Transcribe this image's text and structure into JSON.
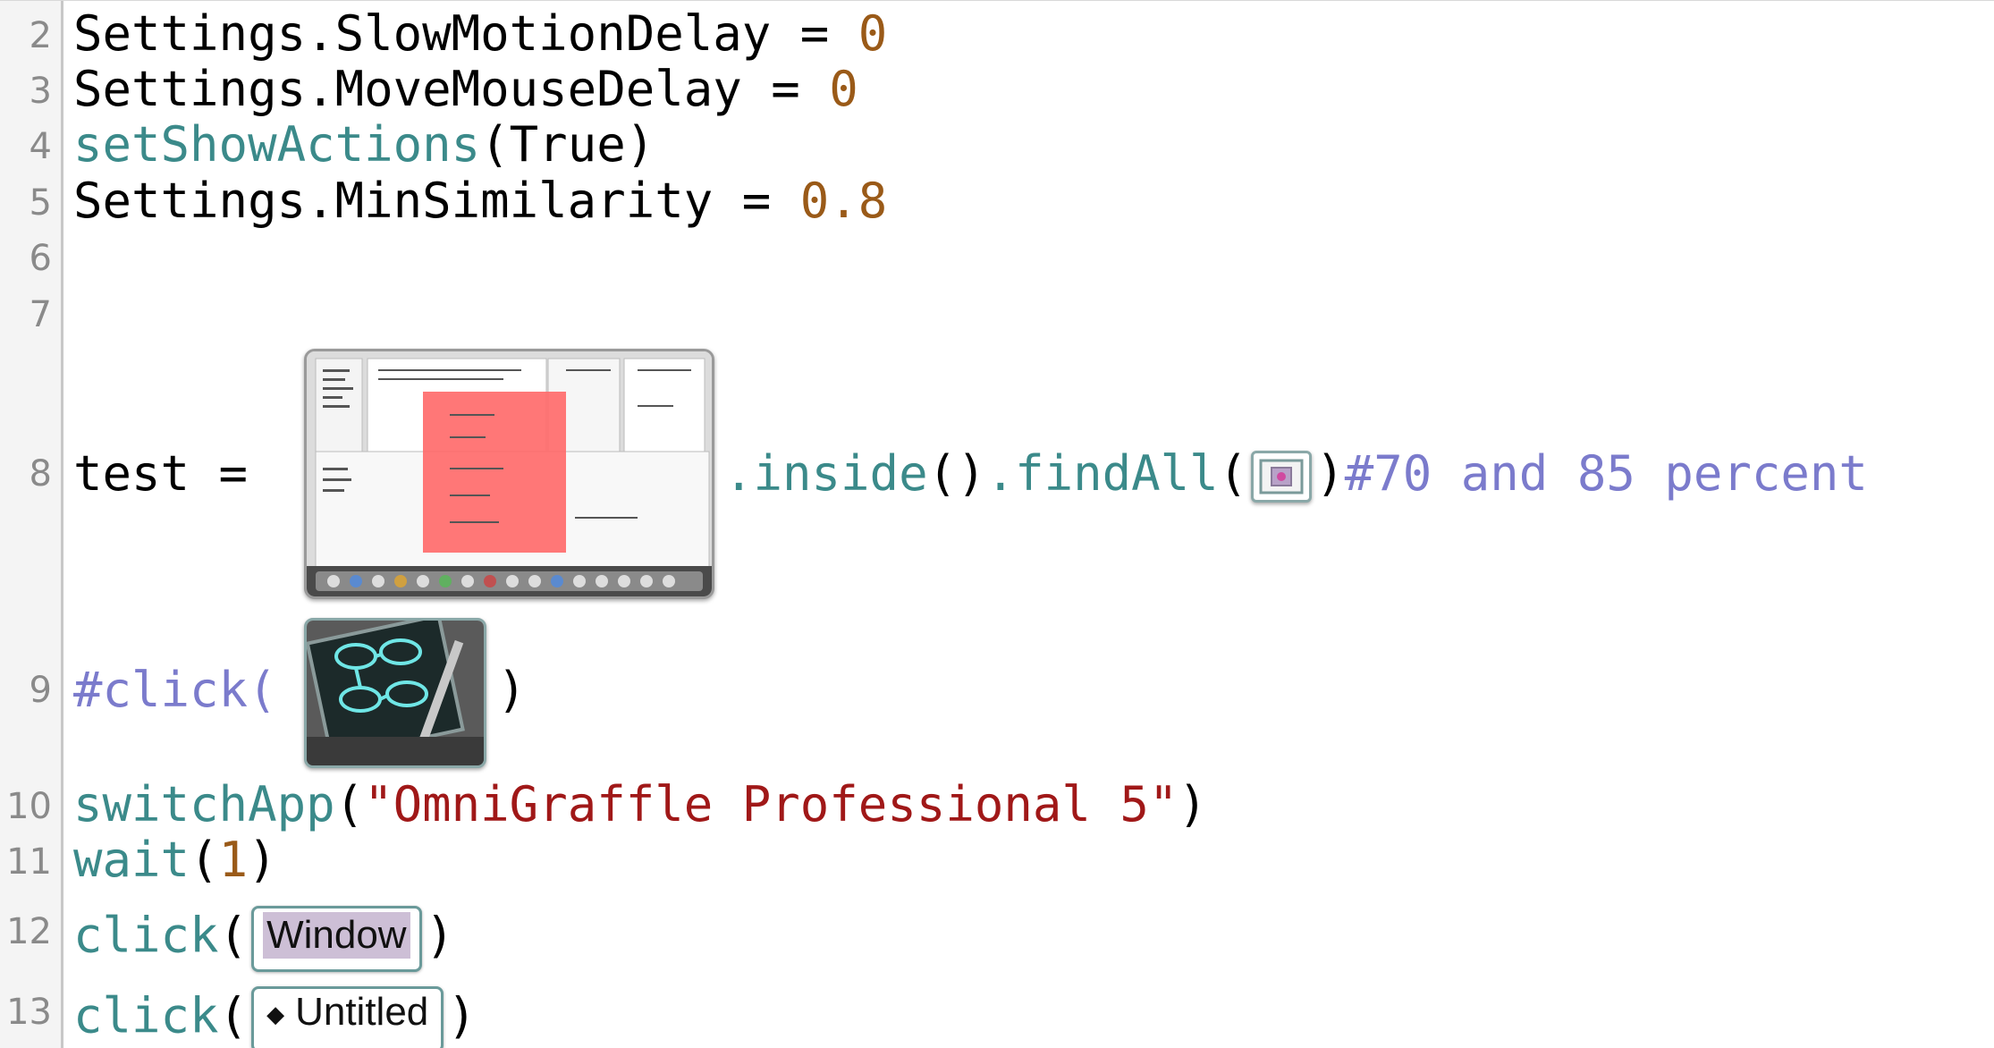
{
  "lines": [
    {
      "num": "2",
      "text": "Settings.SlowMotionDelay = ",
      "value": "0"
    },
    {
      "num": "3",
      "text": "Settings.MoveMouseDelay = ",
      "value": "0"
    },
    {
      "num": "4",
      "fn": "setShowActions",
      "args": "(True)"
    },
    {
      "num": "5",
      "text": "Settings.MinSimilarity = ",
      "value": "0.8"
    },
    {
      "num": "6"
    },
    {
      "num": "7"
    },
    {
      "num": "8",
      "prefix": "test = ",
      "method1": ".inside",
      "paren1": "()",
      "method2": ".findAll",
      "paren_open": "(",
      "paren_close": ")",
      "comment": "#70 and 85 percent"
    },
    {
      "num": "9",
      "comment_open": "#click(",
      "paren_close": ")"
    },
    {
      "num": "10",
      "fn": "switchApp",
      "paren_open": "(",
      "string": "\"OmniGraffle Professional 5\"",
      "paren_close": ")"
    },
    {
      "num": "11",
      "fn": "wait",
      "paren_open": "(",
      "value": "1",
      "paren_close": ")"
    },
    {
      "num": "12",
      "fn": "click",
      "paren_open": "(",
      "button": "Window",
      "paren_close": ")"
    },
    {
      "num": "13",
      "fn": "click",
      "paren_open": "(",
      "button": "Untitled",
      "button_icon": "diamond-icon",
      "paren_close": ")"
    }
  ],
  "colors": {
    "number": "#9a5a18",
    "function": "#3b8a8a",
    "string": "#a01818",
    "comment": "#7b7bcc",
    "highlight": "#ff6b6b"
  }
}
